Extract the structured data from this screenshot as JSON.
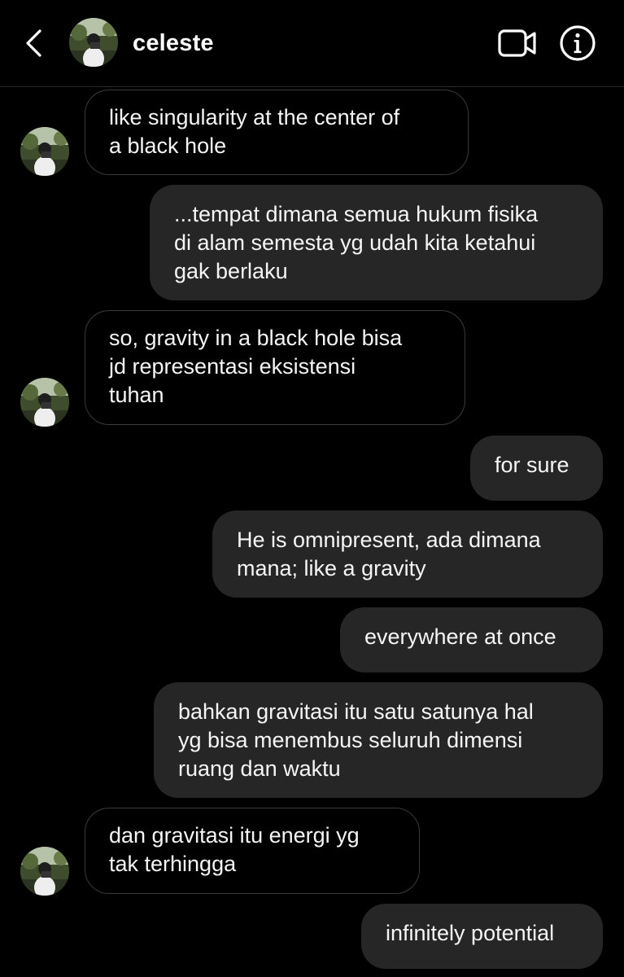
{
  "header": {
    "contact_name": "celeste",
    "icons": {
      "back": "chevron-left-icon",
      "video": "video-camera-icon",
      "info": "info-circle-icon"
    }
  },
  "messages": [
    {
      "direction": "in",
      "text": "like singularity at the center of\na black hole"
    },
    {
      "direction": "out",
      "text": "...tempat dimana semua hukum fisika\ndi alam semesta yg udah kita ketahui\ngak berlaku"
    },
    {
      "direction": "in",
      "text": "so, gravity in a black hole bisa\njd representasi eksistensi\ntuhan"
    },
    {
      "direction": "out",
      "text": "for sure"
    },
    {
      "direction": "out",
      "text": "He is omnipresent, ada dimana\nmana; like a gravity"
    },
    {
      "direction": "out",
      "text": "everywhere at once"
    },
    {
      "direction": "out",
      "text": "bahkan gravitasi itu satu satunya hal\nyg bisa menembus seluruh dimensi\nruang dan waktu"
    },
    {
      "direction": "in",
      "text": "dan gravitasi itu energi yg\ntak terhingga"
    },
    {
      "direction": "out",
      "text": "infinitely potential"
    }
  ],
  "colors": {
    "background": "#000000",
    "outgoing_bubble": "#262626",
    "incoming_border": "#3a3a3a",
    "text": "#f5f5f5"
  }
}
